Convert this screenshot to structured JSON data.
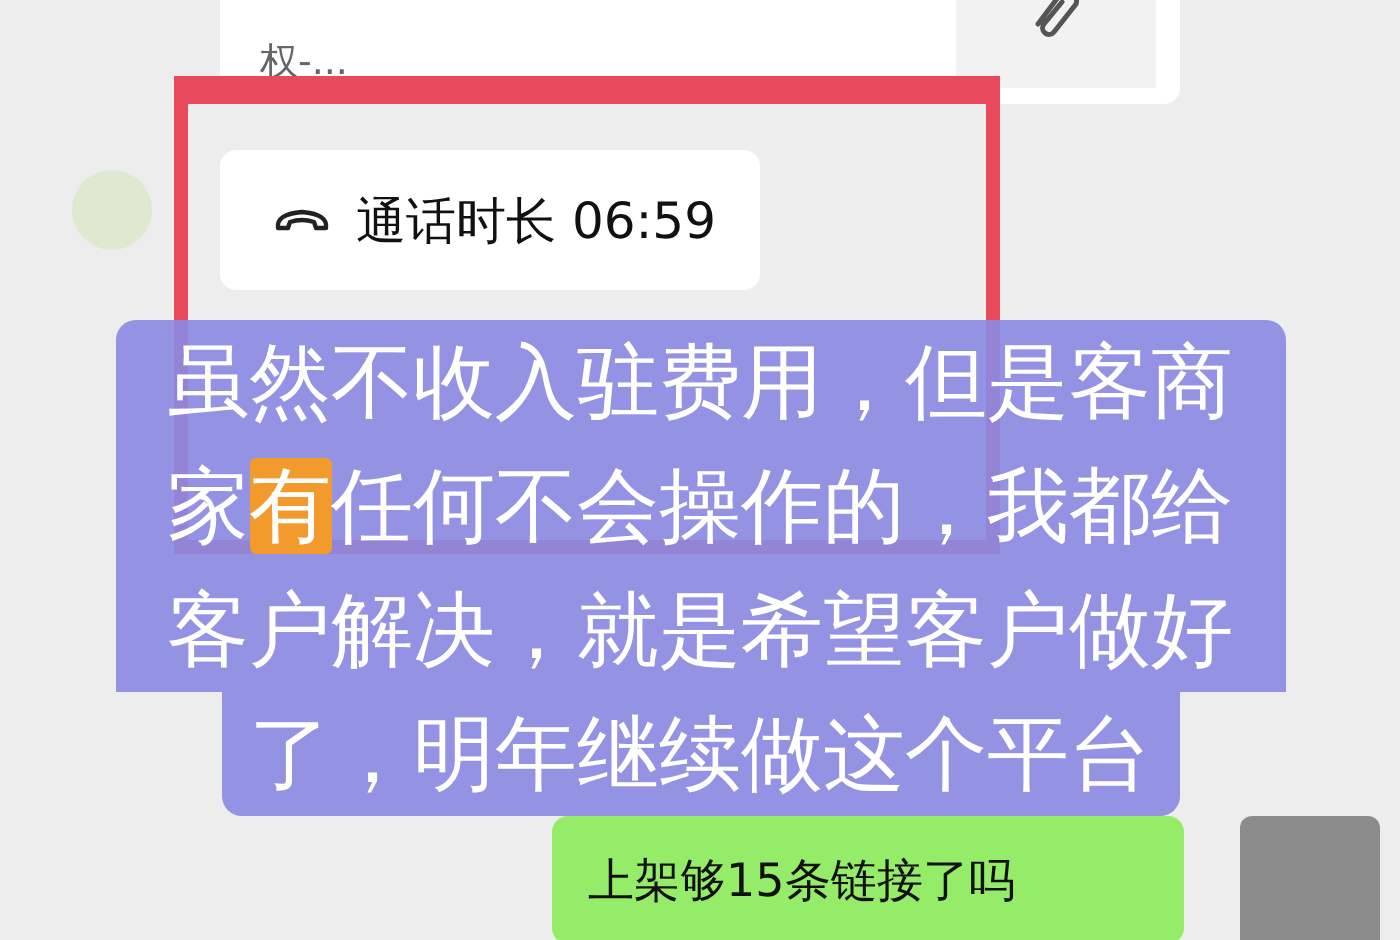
{
  "messages": [
    {
      "kind": "file",
      "text": "权-..."
    },
    {
      "kind": "call",
      "text": "通话时长 06:59"
    },
    {
      "kind": "text",
      "text": "上架够15条链接了吗"
    }
  ],
  "caption": {
    "lines": [
      [
        {
          "text": "虽然不收入驻费用，但是客商",
          "highlight": false
        }
      ],
      [
        {
          "text": "家",
          "highlight": false
        },
        {
          "text": "有",
          "highlight": true
        },
        {
          "text": "任何不会操作的，我都给",
          "highlight": false
        }
      ],
      [
        {
          "text": "客户解决，就是希望客户做好",
          "highlight": false
        }
      ],
      [
        {
          "text": "了，明年继续做这个平台",
          "highlight": false
        }
      ]
    ]
  }
}
